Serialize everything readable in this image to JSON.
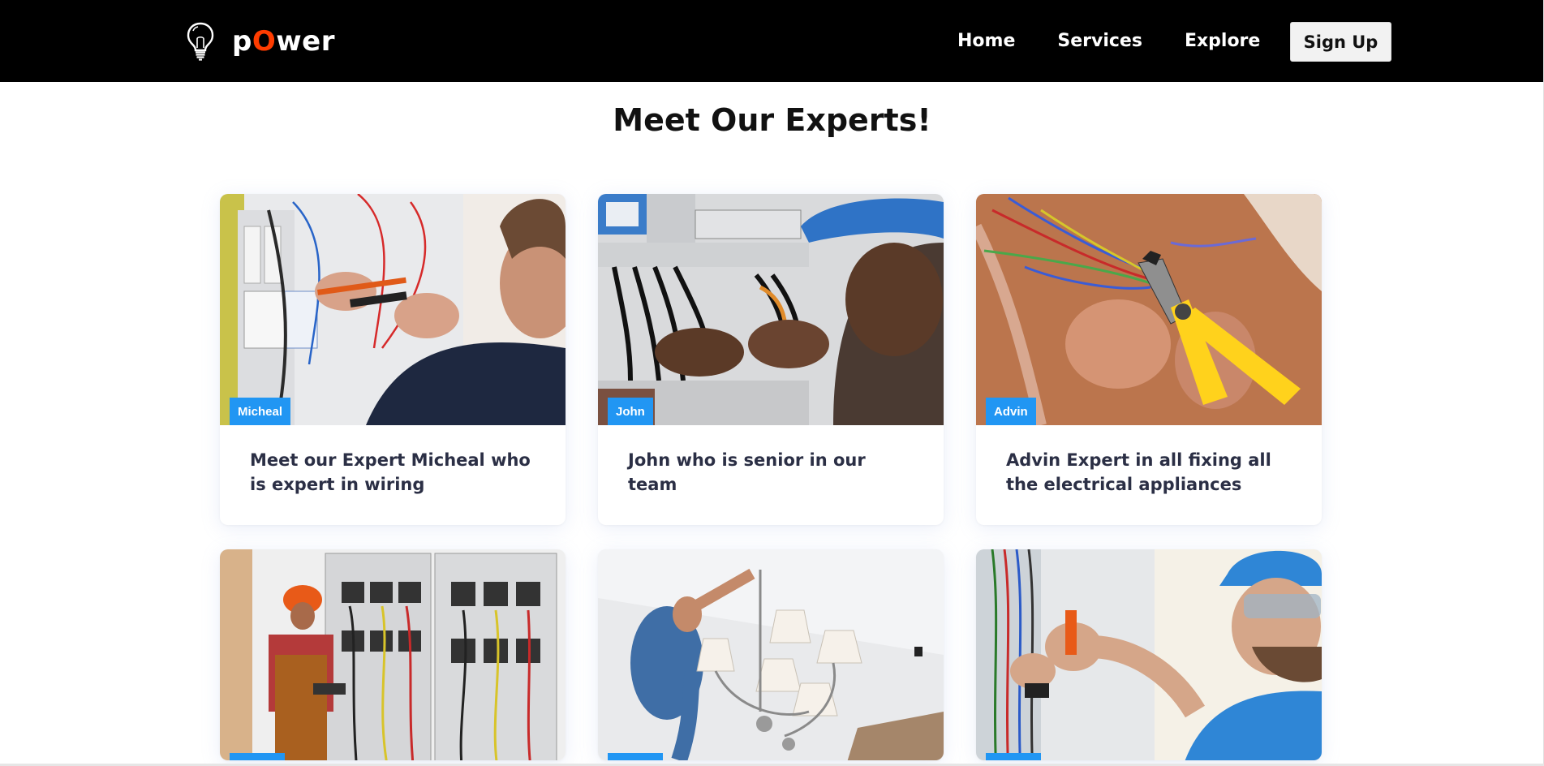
{
  "brand": {
    "prefix": "p",
    "accent": "O",
    "suffix": "wer",
    "accent_color": "#ff3c00"
  },
  "nav": {
    "home": "Home",
    "services": "Services",
    "explore": "Explore",
    "signup": "Sign Up"
  },
  "section": {
    "title": "Meet Our Experts!"
  },
  "experts": [
    {
      "name": "Micheal",
      "description": "Meet our Expert Micheal who is expert in wiring"
    },
    {
      "name": "John",
      "description": "John who is senior in our team"
    },
    {
      "name": "Advin",
      "description": "Advin Expert in all fixing all the electrical appliances"
    },
    {
      "name": "",
      "description": ""
    },
    {
      "name": "",
      "description": ""
    },
    {
      "name": "",
      "description": ""
    }
  ],
  "colors": {
    "navbar_bg": "#000000",
    "badge_bg": "#2196f3",
    "card_text": "#2b2f45"
  },
  "icons": {
    "logo": "light-bulb-icon"
  }
}
